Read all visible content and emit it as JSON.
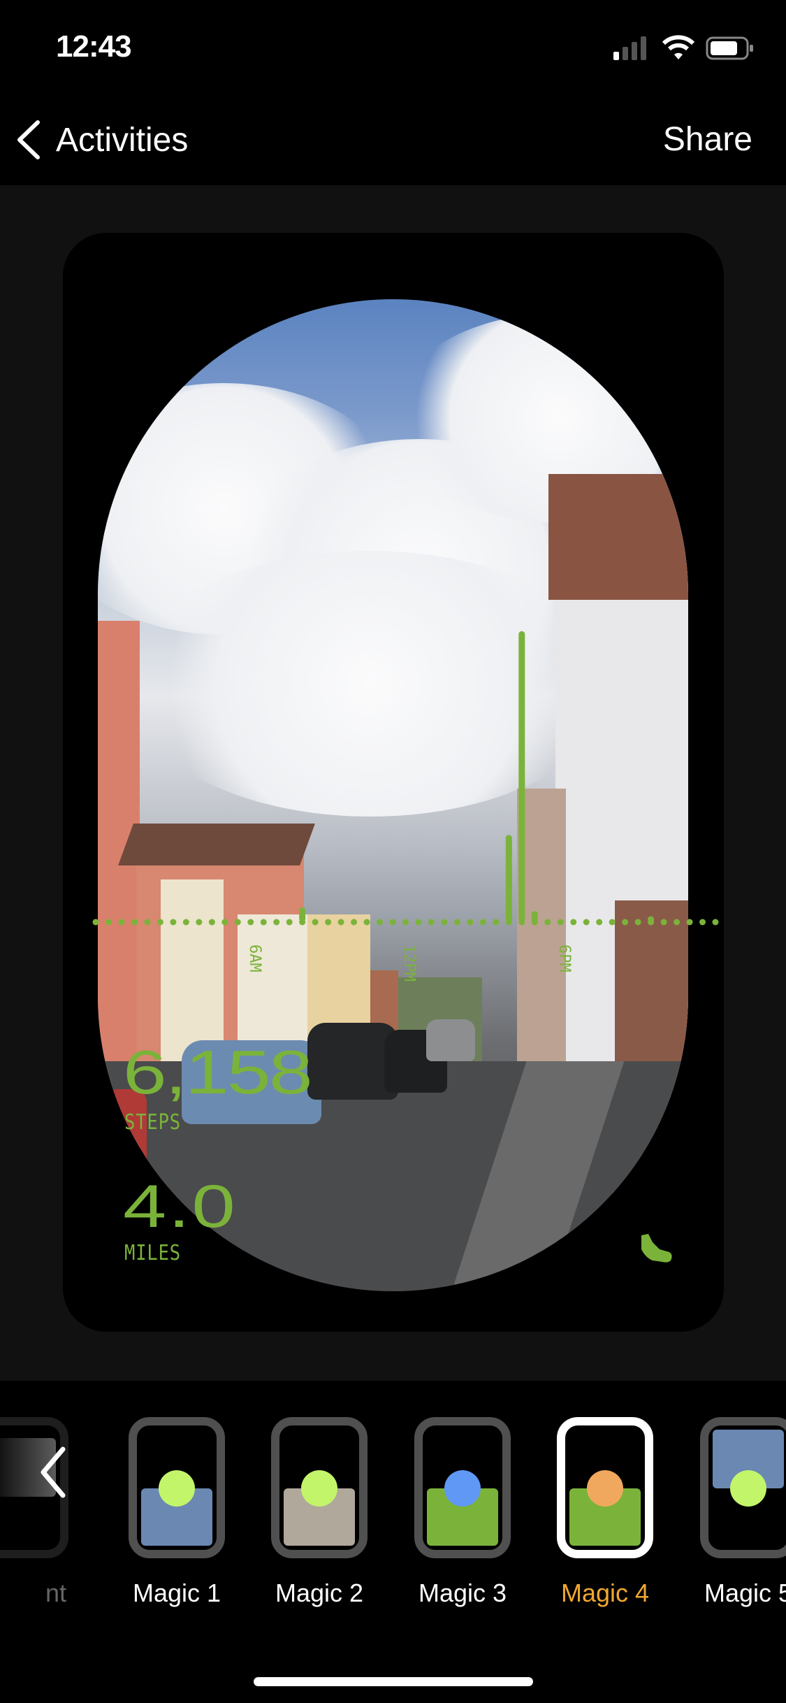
{
  "status_bar": {
    "time": "12:43",
    "icons": [
      "cellular-signal-icon",
      "wifi-icon",
      "battery-icon"
    ]
  },
  "nav": {
    "back_label": "Activities",
    "share_label": "Share"
  },
  "card": {
    "steps_value": "6,158",
    "steps_label": "STEPS",
    "distance_value": "4.0",
    "distance_label": "MILES",
    "activity_icon": "shoe-icon",
    "accent_color": "#7bb33a"
  },
  "chart_data": {
    "type": "bar",
    "x_unit": "time of day",
    "x_range": [
      "12AM",
      "12AM"
    ],
    "bin": "30 minutes",
    "tick_labels": [
      "6AM",
      "12PM",
      "6PM"
    ],
    "bars": [
      {
        "time": "8:00",
        "steps": 222
      },
      {
        "time": "16:00",
        "steps": 1310
      },
      {
        "time": "16:30",
        "steps": 4372
      },
      {
        "time": "17:00",
        "steps": 166
      },
      {
        "time": "21:30",
        "steps": 88
      }
    ],
    "baseline": "dotted",
    "color": "#7bb33a"
  },
  "styles": {
    "items": [
      {
        "label": "nt",
        "partial": true
      },
      {
        "label": "Magic 1",
        "block_color": "#6b88b3",
        "dot_color": "#c3f56a",
        "block": "bottom"
      },
      {
        "label": "Magic 2",
        "block_color": "#b0a89b",
        "dot_color": "#c3f56a",
        "block": "bottom"
      },
      {
        "label": "Magic 3",
        "block_color": "#7bb33a",
        "dot_color": "#6098f5",
        "block": "bottom"
      },
      {
        "label": "Magic 4",
        "block_color": "#7bb33a",
        "dot_color": "#f0a85e",
        "block": "bottom",
        "selected": true
      },
      {
        "label": "Magic 5",
        "block_color": "#6b88b3",
        "dot_color": "#c3f56a",
        "block": "top"
      }
    ],
    "selected_label_color": "#f0a830"
  }
}
